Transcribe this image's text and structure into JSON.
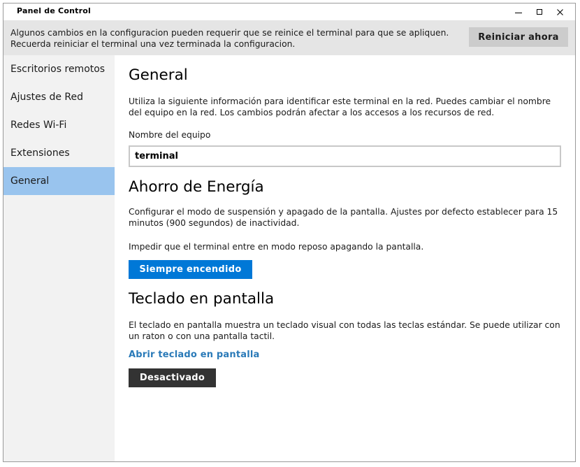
{
  "window": {
    "title": "Panel de Control"
  },
  "notice": {
    "text": "Algunos cambios en la configuracion pueden requerir que se reinice el terminal para que se apliquen. Recuerda reiniciar el terminal una vez terminada la configuracion.",
    "restart_label": "Reiniciar ahora"
  },
  "sidebar": {
    "items": [
      {
        "label": "Escritorios remotos"
      },
      {
        "label": "Ajustes de Red"
      },
      {
        "label": "Redes Wi-Fi"
      },
      {
        "label": "Extensiones"
      },
      {
        "label": "General"
      }
    ],
    "active": "General"
  },
  "general": {
    "heading": "General",
    "description": "Utiliza la siguiente información para identificar este terminal en la red. Puedes cambiar el nombre del equipo en la red. Los cambios podrán afectar a los accesos a los recursos de red.",
    "name_label": "Nombre del equipo",
    "name_value": "terminal"
  },
  "energy": {
    "heading": "Ahorro de Energía",
    "description": "Configurar el modo de suspensión y apagado de la pantalla. Ajustes por defecto establecer para 15 minutos (900 segundos) de inactividad.",
    "prevent_text": "Impedir que el terminal entre en modo reposo apagando la pantalla.",
    "always_on_label": "Siempre encendido"
  },
  "keyboard": {
    "heading": "Teclado en pantalla",
    "description": "El teclado en pantalla muestra un teclado visual con todas las teclas estándar. Se puede utilizar con un raton o con una pantalla tactil.",
    "open_link": "Abrir teclado en pantalla",
    "status_label": "Desactivado"
  },
  "colors": {
    "accent": "#0078d7",
    "sidebar_active": "#99c4ee",
    "dark_button": "#333333",
    "link": "#2a7ab8"
  }
}
